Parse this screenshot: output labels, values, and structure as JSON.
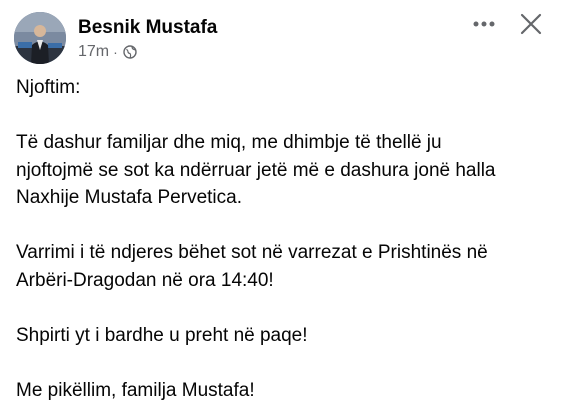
{
  "post": {
    "author": {
      "name": "Besnik Mustafa",
      "avatar_icon": "profile-photo"
    },
    "meta": {
      "time": "17m",
      "separator": "·",
      "audience_icon": "globe-icon"
    },
    "actions": {
      "more_icon": "more-horizontal-icon",
      "close_icon": "close-icon"
    },
    "paragraphs": [
      "Njoftim:",
      "Të dashur familjar dhe miq, me dhimbje të thellë ju\nnjoftojmë se sot ka ndërruar jetë më e dashura jonë halla\nNaxhije Mustafa Pervetica.",
      "Varrimi i të ndjeres bëhet sot në varrezat  e Prishtinës në\nArbëri-Dragodan në ora 14:40!",
      "Shpirti yt i bardhe u preht në paqe!",
      "Me pikëllim, familja Mustafa!"
    ]
  },
  "colors": {
    "text_primary": "#050505",
    "text_secondary": "#65676b",
    "background": "#ffffff"
  }
}
